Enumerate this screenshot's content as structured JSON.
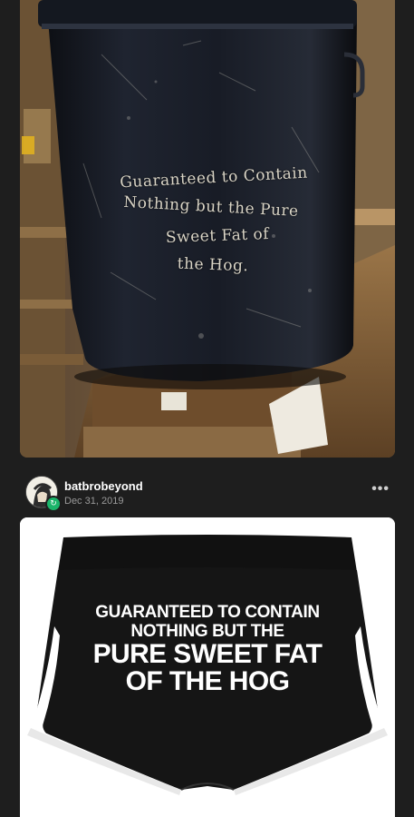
{
  "posts": [
    {
      "image": {
        "subject": "barrel",
        "lettering": [
          "Guaranteed to Contain",
          "Nothing but the Pure",
          "Sweet Fat of",
          "the Hog."
        ]
      }
    },
    {
      "header": {
        "username": "batbrobeyond",
        "date": "Dec 31, 2019",
        "more_label": "•••",
        "reblog_icon": "reblog-icon"
      },
      "image": {
        "subject": "shorts",
        "lettering_small": [
          "GUARANTEED TO CONTAIN",
          "NOTHING BUT THE"
        ],
        "lettering_big": [
          "PURE SWEET FAT",
          "OF THE HOG"
        ]
      }
    }
  ],
  "colors": {
    "background": "#1e1e1e",
    "username": "#ffffff",
    "date": "#9a9a9a",
    "reblog_badge": "#1bb46a"
  }
}
